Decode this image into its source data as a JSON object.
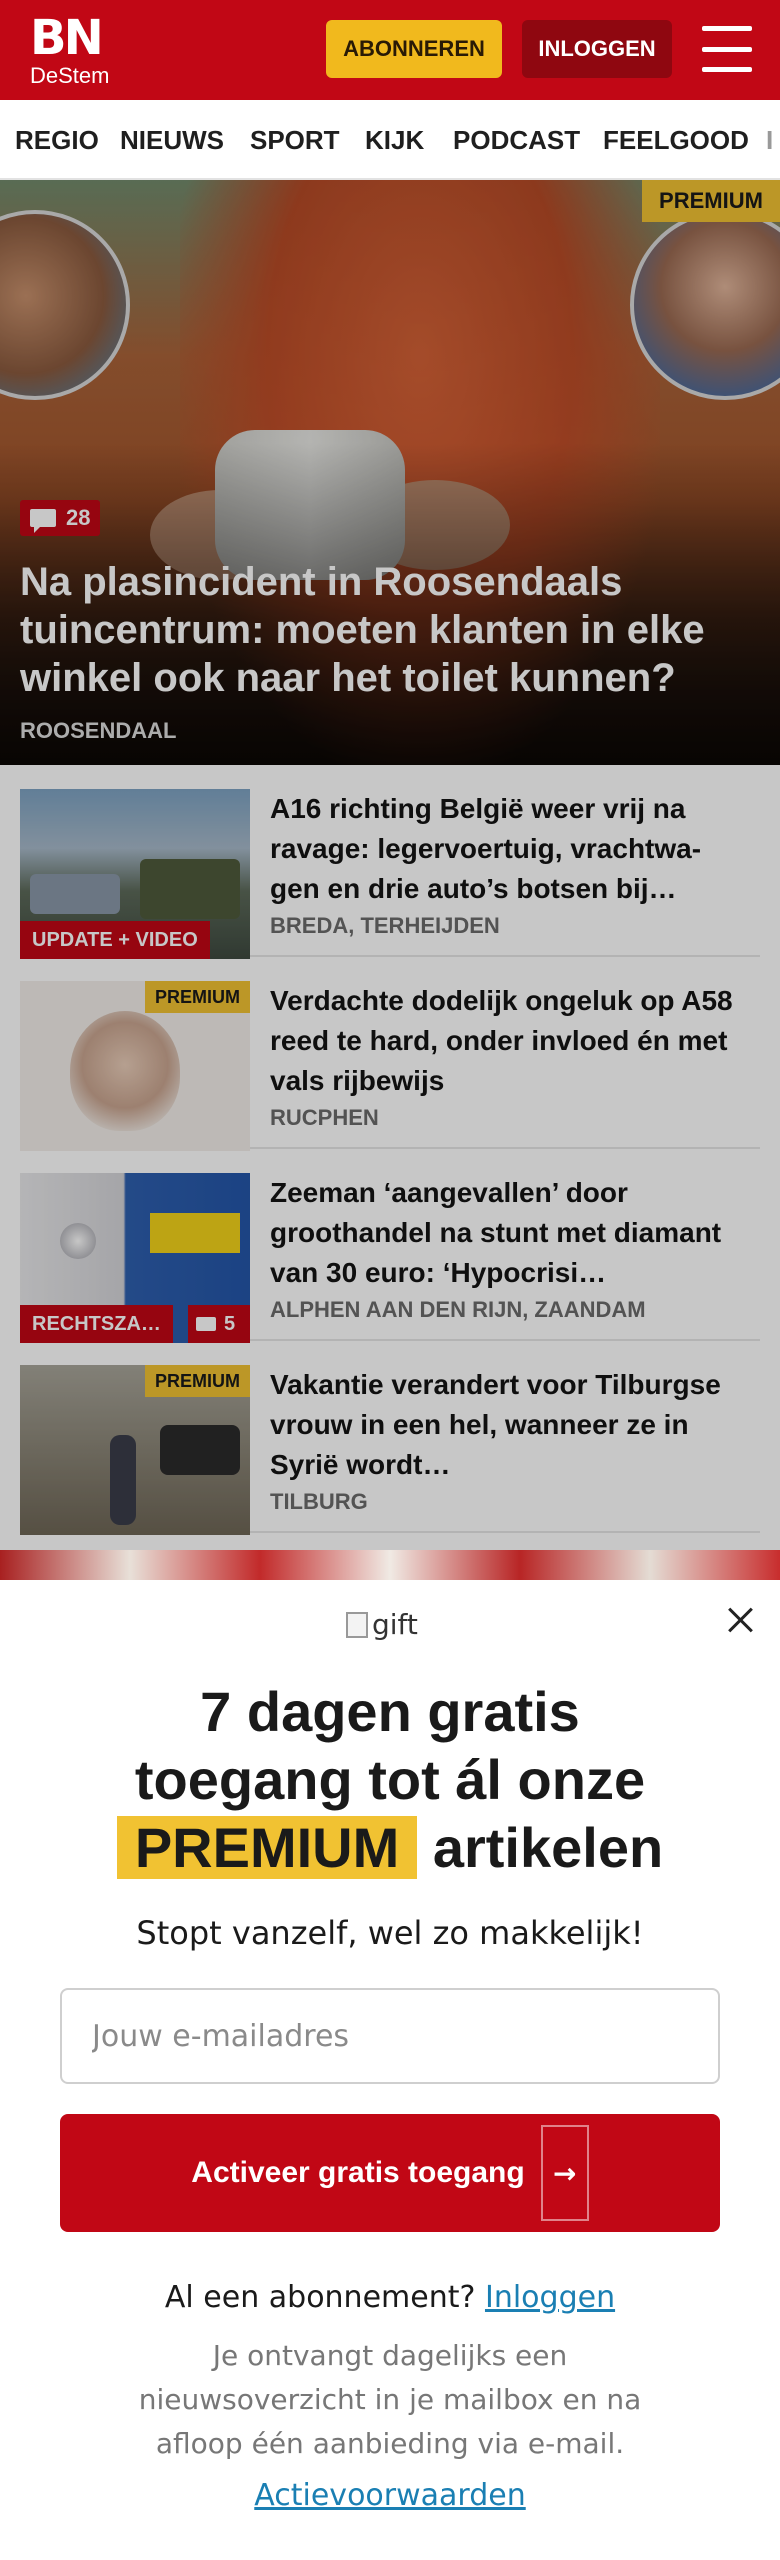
{
  "header": {
    "logo_main": "BN",
    "logo_sub": "DeStem",
    "subscribe_label": "ABONNEREN",
    "login_label": "INLOGGEN"
  },
  "nav": {
    "items": [
      "REGIO",
      "NIEUWS",
      "SPORT",
      "KIJK",
      "PODCAST",
      "FEELGOOD",
      "I"
    ]
  },
  "hero": {
    "premium_label": "PREMIUM",
    "comment_count": "28",
    "title": "Na plasincident in Roosendaals tuincentrum: moeten klanten in elke winkel ook naar het toilet kunnen?",
    "location": "ROOSENDAAL"
  },
  "articles": [
    {
      "title": "A16 richting België weer vrij na ravage: legervoertuig, vrachtwa­gen en drie auto’s botsen bij…",
      "location": "BREDA, TERHEIJDEN",
      "tag": "UPDATE + VIDEO"
    },
    {
      "title": "Verdachte dodelijk ongeluk op A58 reed te hard, onder invloed én met vals rijbewijs",
      "location": "RUCPHEN",
      "premium_label": "PREMIUM"
    },
    {
      "title": "Zeeman ‘aangevallen’ door groothandel na stunt met diamant van 30 euro: ‘Hypocrisi…",
      "location": "ALPHEN AAN DEN RIJN, ZAANDAM",
      "tag": "RECHTSZA…",
      "comment_count": "5"
    },
    {
      "title": "Vakantie verandert voor Tilburgse vrouw in een hel, wanneer ze in Syrië wordt…",
      "location": "TILBURG",
      "premium_label": "PREMIUM"
    }
  ],
  "modal": {
    "gift_alt": "gift",
    "title_line1": "7 dagen gratis",
    "title_line2": "toegang tot ál onze",
    "title_highlight": "PREMIUM",
    "title_line3_rest": "artikelen",
    "subtitle": "Stopt vanzelf, wel zo makkelijk!",
    "email_placeholder": "Jouw e-mailadres",
    "cta_label": "Activeer gratis toegang",
    "cta_icon_alt": "arrow-right",
    "already_text": "Al een abonnement?",
    "already_link": "Inloggen",
    "info_text": "Je ontvangt dagelijks een nieuwsoverzicht in je mailbox en na afloop één aanbieding via e-mail.",
    "terms_link": "Actievoorwaarden"
  },
  "colors": {
    "brand_red": "#c10715",
    "premium_yellow": "#f1c232",
    "link_blue": "#1a7fb3"
  }
}
